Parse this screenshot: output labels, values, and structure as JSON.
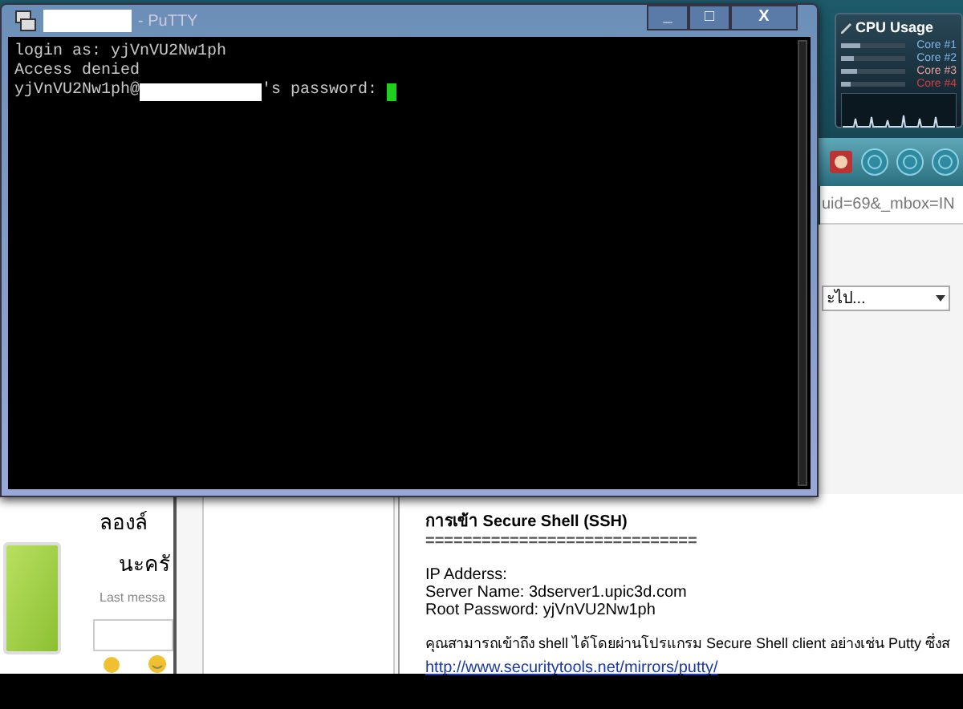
{
  "putty": {
    "title": "- PuTTY",
    "buttons": [
      "_",
      "□",
      "X"
    ],
    "lines": [
      "login as: yjVnVU2Nw1ph",
      "Access denied"
    ],
    "prompt": {
      "user": "yjVnVU2Nw1ph@",
      "suffix": "'s password: "
    }
  },
  "cpu_gadget": {
    "title": "CPU Usage",
    "cores": [
      {
        "label": "Core #1",
        "color": "#7fb8e8",
        "level": 0.3
      },
      {
        "label": "Core #2",
        "color": "#7fb8e8",
        "level": 0.2
      },
      {
        "label": "Core #3",
        "color": "#e8a0a0",
        "level": 0.25
      },
      {
        "label": "Core #4",
        "color": "#d04040",
        "level": 0.15
      }
    ]
  },
  "browser": {
    "address": "uid=69&_mbox=IN",
    "dropdown": "ะไป...",
    "chat": {
      "bullet_text": "ลองล์",
      "text": "นะครั",
      "last_message": "Last messa"
    },
    "article": {
      "heading": "การเข้า Secure Shell (SSH)",
      "rule": "=============================",
      "lines": [
        "IP Adderss:",
        "Server Name: 3dserver1.upic3d.com",
        "Root Password: yjVnVU2Nw1ph"
      ],
      "paragraph": "คุณสามารถเข้าถึง shell ได้โดยผ่านโปรแกรม Secure Shell client อย่างเช่น Putty ซึ่งส",
      "link": "http://www.securitytools.net/mirrors/putty/"
    }
  }
}
